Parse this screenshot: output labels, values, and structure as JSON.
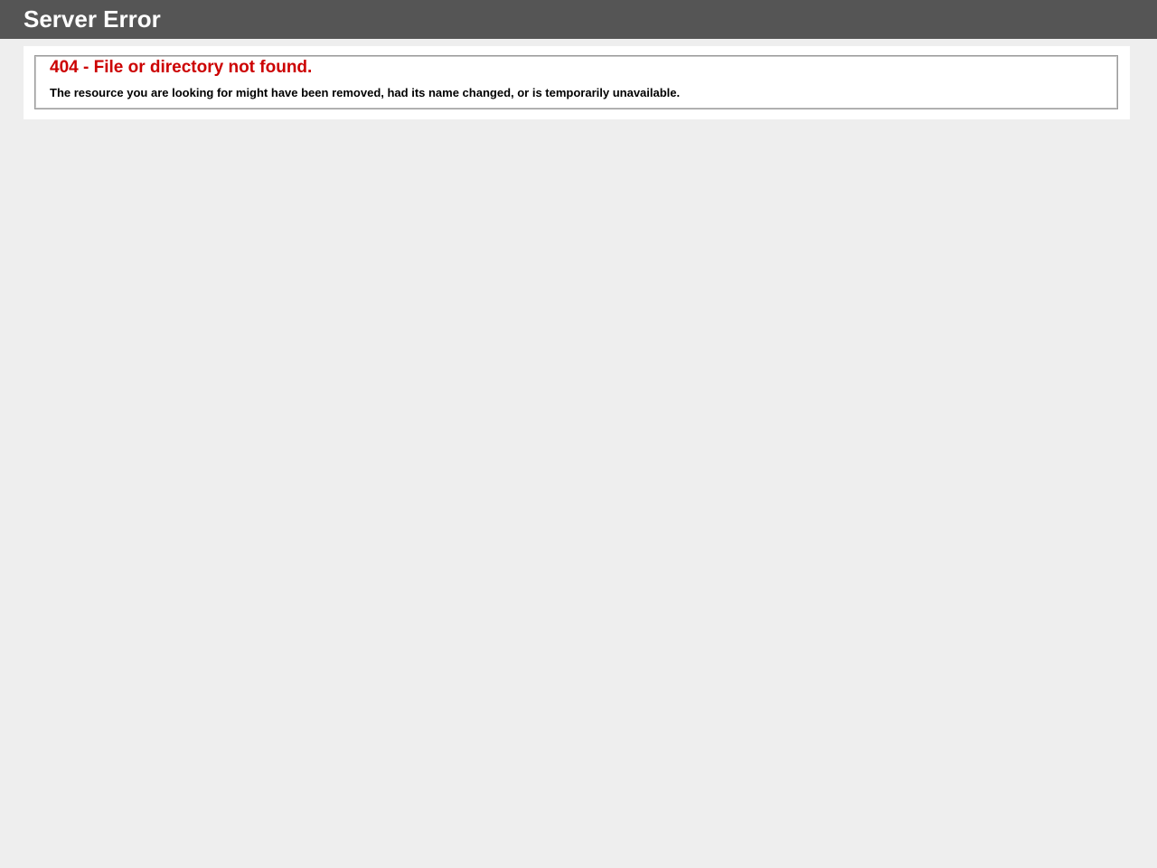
{
  "header": {
    "title": "Server Error"
  },
  "error": {
    "heading": "404 - File or directory not found.",
    "message": "The resource you are looking for might have been removed, had its name changed, or is temporarily unavailable."
  },
  "colors": {
    "header_bg": "#555555",
    "page_bg": "#eeeeee",
    "error_heading": "#cc0000"
  }
}
